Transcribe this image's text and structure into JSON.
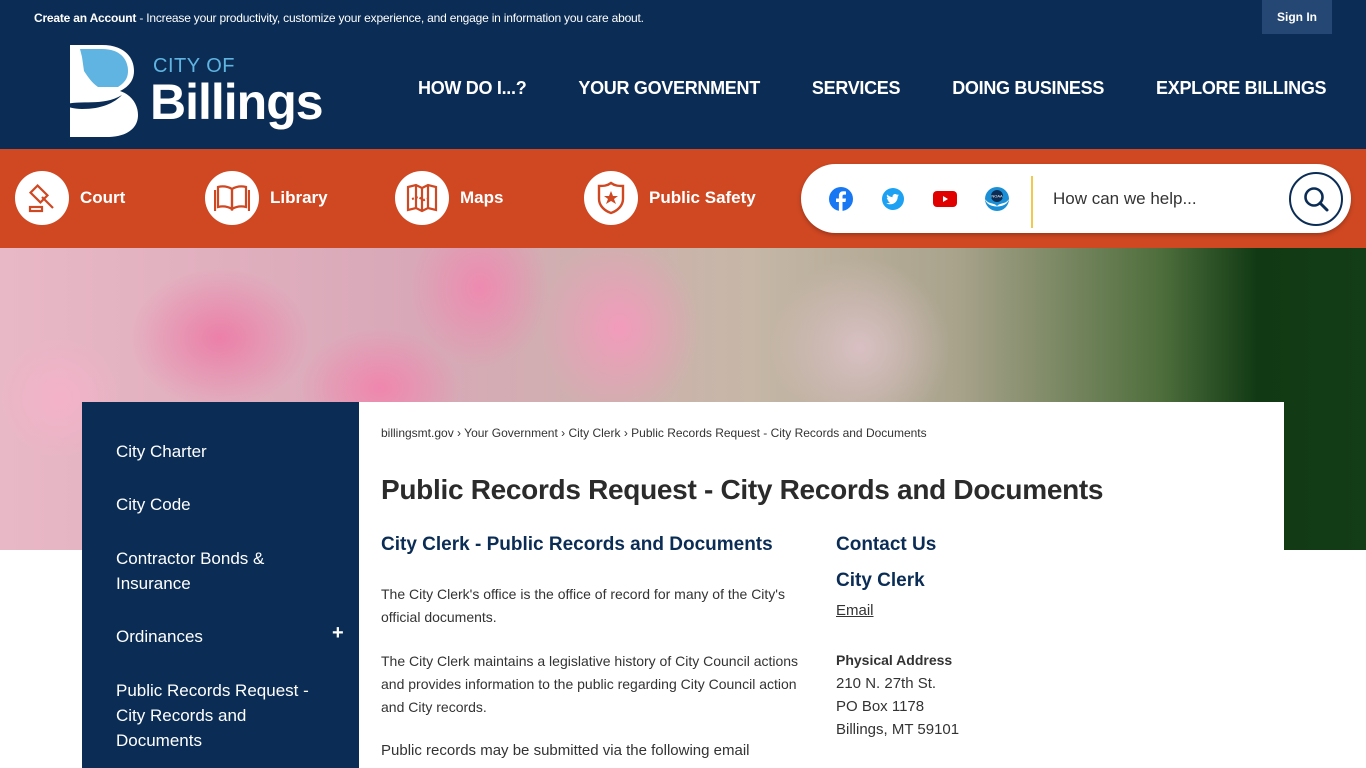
{
  "topbar": {
    "account_link": "Create an Account",
    "account_text": " - Increase your productivity, customize your experience, and engage in information you care about.",
    "signin_label": "Sign In"
  },
  "header": {
    "logo_city_of": "CITY OF",
    "logo_name": "Billings",
    "nav": [
      "HOW DO I...?",
      "YOUR GOVERNMENT",
      "SERVICES",
      "DOING BUSINESS",
      "EXPLORE BILLINGS"
    ]
  },
  "quicklinks": [
    {
      "label": "Court",
      "icon": "gavel-icon"
    },
    {
      "label": "Library",
      "icon": "book-icon"
    },
    {
      "label": "Maps",
      "icon": "map-icon"
    },
    {
      "label": "Public Safety",
      "icon": "badge-icon"
    }
  ],
  "social": [
    {
      "name": "facebook-icon",
      "color": "#1877f2"
    },
    {
      "name": "twitter-icon",
      "color": "#1da1f2"
    },
    {
      "name": "youtube-icon",
      "color": "#e00000"
    },
    {
      "name": "noaa-icon",
      "color": "#1a8fd6"
    }
  ],
  "search": {
    "placeholder": "How can we help..."
  },
  "sidebar": {
    "items": [
      {
        "label": "City Charter"
      },
      {
        "label": "City Code"
      },
      {
        "label": "Contractor Bonds & Insurance"
      },
      {
        "label": "Ordinances",
        "expand": "+"
      },
      {
        "label": "Public Records Request - City Records and Documents"
      }
    ]
  },
  "breadcrumb": {
    "items": [
      "billingsmt.gov",
      "Your Government",
      "City Clerk",
      "Public Records Request - City Records and Documents"
    ],
    "separator": "›"
  },
  "main": {
    "title": "Public Records Request - City Records and Documents",
    "subtitle": "City Clerk - Public Records and Documents",
    "paragraphs": [
      "The City Clerk's office is the office of record for many of the City's official documents.",
      "The City Clerk maintains a legislative history of City Council actions and provides information to the public regarding City Council action and City records.",
      "Public records may be submitted via the following email"
    ]
  },
  "contact": {
    "heading": "Contact Us",
    "name": "City Clerk",
    "email_label": "Email",
    "address_label": "Physical Address",
    "address_lines": [
      "210 N. 27th St.",
      "PO Box 1178",
      "Billings, MT 59101"
    ]
  },
  "colors": {
    "navy": "#0b2d55",
    "orange": "#cf4822",
    "accent_blue": "#5fb4e2"
  }
}
